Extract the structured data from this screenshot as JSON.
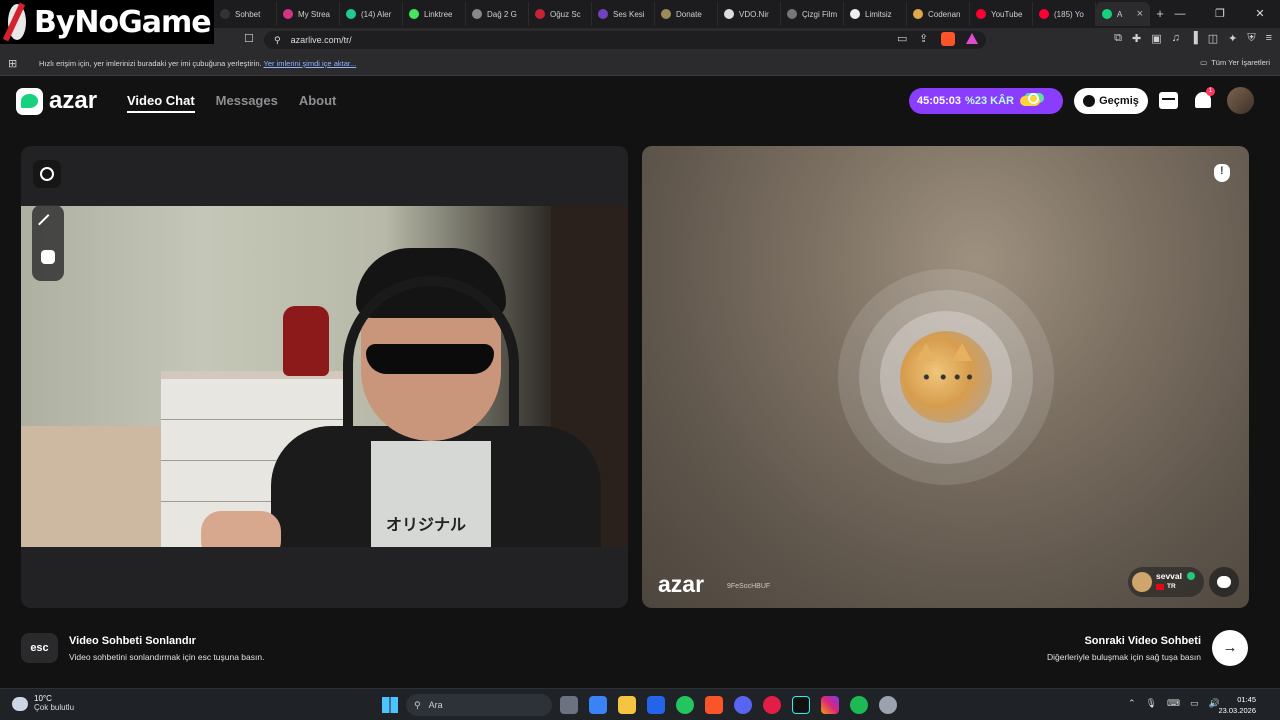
{
  "watermark_logo": "ByNoGame",
  "browser": {
    "tabs": [
      {
        "label": "Sohbet",
        "color": "#333"
      },
      {
        "label": "My Strea",
        "color": "#d63384"
      },
      {
        "label": "(14) Aler",
        "color": "#20c997"
      },
      {
        "label": "Linktree",
        "color": "#43e660"
      },
      {
        "label": "Dağ 2 G",
        "color": "#888888"
      },
      {
        "label": "Oğuz Sc",
        "color": "#c82333"
      },
      {
        "label": "Ses Kesi",
        "color": "#6f42c1"
      },
      {
        "label": "Donate",
        "color": "#9a8b5a"
      },
      {
        "label": "VDO.Nir",
        "color": "#dddddd"
      },
      {
        "label": "Çizgi Film",
        "color": "#777777"
      },
      {
        "label": "Limitsiz",
        "color": "#eeeeee"
      },
      {
        "label": "Codenan",
        "color": "#e0a84d"
      },
      {
        "label": "YouTube",
        "color": "#ff0033"
      },
      {
        "label": "(185) Yo",
        "color": "#ff0033"
      },
      {
        "label": "A",
        "color": "#16d27e"
      }
    ],
    "new_tab": "+",
    "url": "azarlive.com/tr/",
    "bookmark_hint": "Hızlı erişim için, yer imlerinizi buradaki yer imi çubuğuna yerleştirin.",
    "bookmark_import": "Yer imlerini şimdi içe aktar...",
    "all_bookmarks": "Tüm Yer İşaretleri"
  },
  "app": {
    "logo": "azar",
    "nav": [
      {
        "label": "Video Chat",
        "active": true
      },
      {
        "label": "Messages",
        "active": false
      },
      {
        "label": "About",
        "active": false
      }
    ],
    "timer": "45:05:03",
    "profit": "%23 KÂR",
    "history_label": "Geçmiş",
    "notification_count": "1",
    "remote": {
      "watermark": "azar",
      "peer_id": "9FeSocHBUF",
      "peer_name": "sevval",
      "peer_country": "TR"
    },
    "self_shirt_text": "オリジナル",
    "footer": {
      "esc_key": "esc",
      "end_title": "Video Sohbeti Sonlandır",
      "end_desc": "Video sohbetini sonlandırmak için esc tuşuna basın.",
      "next_title": "Sonraki Video Sohbeti",
      "next_desc": "Diğerleriyle buluşmak için sağ tuşa basın",
      "next_arrow": "→"
    }
  },
  "taskbar": {
    "temperature": "10°C",
    "weather": "Çok bulutlu",
    "search_placeholder": "Ara",
    "time": "01:45",
    "date": "23.03.2026"
  }
}
